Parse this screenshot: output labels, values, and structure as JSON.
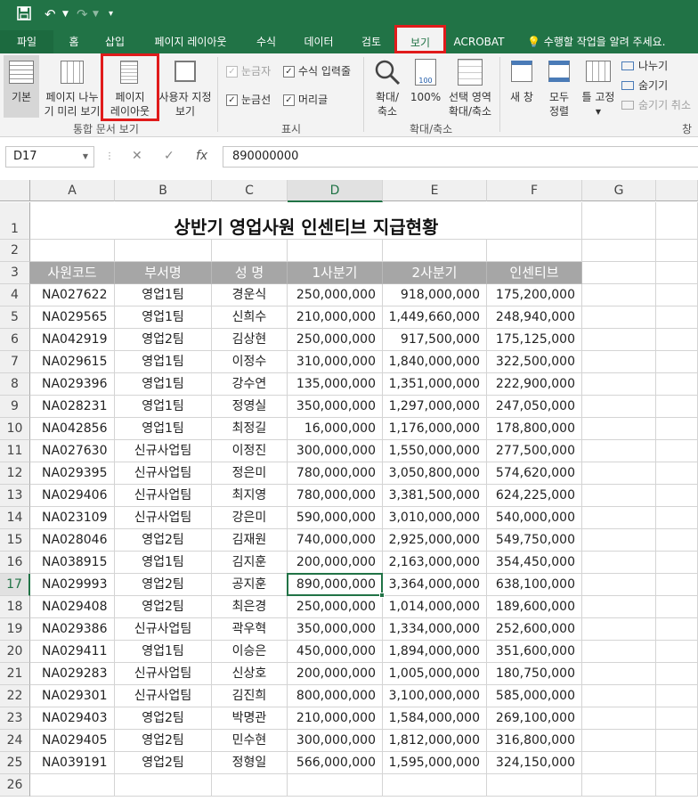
{
  "qat": {
    "save_icon": "save-icon",
    "undo_icon": "undo-icon",
    "redo_icon": "redo-icon",
    "customize_icon": "customize-icon"
  },
  "tabs": [
    "파일",
    "홈",
    "삽입",
    "페이지 레이아웃",
    "수식",
    "데이터",
    "검토",
    "보기",
    "ACROBAT"
  ],
  "active_tab": "보기",
  "tell_me": "수행할 작업을 알려 주세요.",
  "ribbon": {
    "normal": "기본",
    "page_break_line1": "페이지 나누",
    "page_break_line2": "기 미리 보기",
    "page_layout_line1": "페이지",
    "page_layout_line2": "레이아웃",
    "custom_line1": "사용자 지정",
    "custom_line2": "보기",
    "group_workbook_views": "통합 문서 보기",
    "ruler": "눈금자",
    "formula_bar": "수식 입력줄",
    "gridlines": "눈금선",
    "headings": "머리글",
    "group_show": "표시",
    "zoom_line1": "확대/",
    "zoom_line2": "축소",
    "zoom100": "100%",
    "zoom_sel_line1": "선택 영역",
    "zoom_sel_line2": "확대/축소",
    "group_zoom": "확대/축소",
    "new_window": "새 창",
    "arrange_line1": "모두",
    "arrange_line2": "정렬",
    "freeze": "틀 고정",
    "split": "나누기",
    "hide": "숨기기",
    "unhide": "숨기기 취소",
    "group_window": "창",
    "accent": "#217346",
    "highlight": "#e01b1b"
  },
  "formula_bar": {
    "name_box": "D17",
    "cancel": "✕",
    "enter": "✓",
    "fx": "fx",
    "value": "890000000"
  },
  "sheet": {
    "col_headers": [
      "A",
      "B",
      "C",
      "D",
      "E",
      "F",
      "G"
    ],
    "selected_col": "D",
    "selected_row": "17",
    "title": "상반기 영업사원 인센티브 지급현황",
    "table_headers": [
      "사원코드",
      "부서명",
      "성  명",
      "1사분기",
      "2사분기",
      "인센티브"
    ],
    "rows": [
      [
        "NA027622",
        "영업1팀",
        "경운식",
        "250,000,000",
        "918,000,000",
        "175,200,000"
      ],
      [
        "NA029565",
        "영업1팀",
        "신희수",
        "210,000,000",
        "1,449,660,000",
        "248,940,000"
      ],
      [
        "NA042919",
        "영업2팀",
        "김상현",
        "250,000,000",
        "917,500,000",
        "175,125,000"
      ],
      [
        "NA029615",
        "영업1팀",
        "이정수",
        "310,000,000",
        "1,840,000,000",
        "322,500,000"
      ],
      [
        "NA029396",
        "영업1팀",
        "강수연",
        "135,000,000",
        "1,351,000,000",
        "222,900,000"
      ],
      [
        "NA028231",
        "영업1팀",
        "정영실",
        "350,000,000",
        "1,297,000,000",
        "247,050,000"
      ],
      [
        "NA042856",
        "영업1팀",
        "최정길",
        "16,000,000",
        "1,176,000,000",
        "178,800,000"
      ],
      [
        "NA027630",
        "신규사업팀",
        "이정진",
        "300,000,000",
        "1,550,000,000",
        "277,500,000"
      ],
      [
        "NA029395",
        "신규사업팀",
        "정은미",
        "780,000,000",
        "3,050,800,000",
        "574,620,000"
      ],
      [
        "NA029406",
        "신규사업팀",
        "최지영",
        "780,000,000",
        "3,381,500,000",
        "624,225,000"
      ],
      [
        "NA023109",
        "신규사업팀",
        "강은미",
        "590,000,000",
        "3,010,000,000",
        "540,000,000"
      ],
      [
        "NA028046",
        "영업2팀",
        "김재원",
        "740,000,000",
        "2,925,000,000",
        "549,750,000"
      ],
      [
        "NA038915",
        "영업1팀",
        "김지훈",
        "200,000,000",
        "2,163,000,000",
        "354,450,000"
      ],
      [
        "NA029993",
        "영업2팀",
        "공지훈",
        "890,000,000",
        "3,364,000,000",
        "638,100,000"
      ],
      [
        "NA029408",
        "영업2팀",
        "최은경",
        "250,000,000",
        "1,014,000,000",
        "189,600,000"
      ],
      [
        "NA029386",
        "신규사업팀",
        "곽우혁",
        "350,000,000",
        "1,334,000,000",
        "252,600,000"
      ],
      [
        "NA029411",
        "영업1팀",
        "이승은",
        "450,000,000",
        "1,894,000,000",
        "351,600,000"
      ],
      [
        "NA029283",
        "신규사업팀",
        "신상호",
        "200,000,000",
        "1,005,000,000",
        "180,750,000"
      ],
      [
        "NA029301",
        "신규사업팀",
        "김진희",
        "800,000,000",
        "3,100,000,000",
        "585,000,000"
      ],
      [
        "NA029403",
        "영업2팀",
        "박명관",
        "210,000,000",
        "1,584,000,000",
        "269,100,000"
      ],
      [
        "NA029405",
        "영업2팀",
        "민수현",
        "300,000,000",
        "1,812,000,000",
        "316,800,000"
      ],
      [
        "NA039191",
        "영업2팀",
        "정형일",
        "566,000,000",
        "1,595,000,000",
        "324,150,000"
      ]
    ],
    "row_numbers": [
      "1",
      "2",
      "3",
      "4",
      "5",
      "6",
      "7",
      "8",
      "9",
      "10",
      "11",
      "12",
      "13",
      "14",
      "15",
      "16",
      "17",
      "18",
      "19",
      "20",
      "21",
      "22",
      "23",
      "24",
      "25",
      "26"
    ]
  }
}
